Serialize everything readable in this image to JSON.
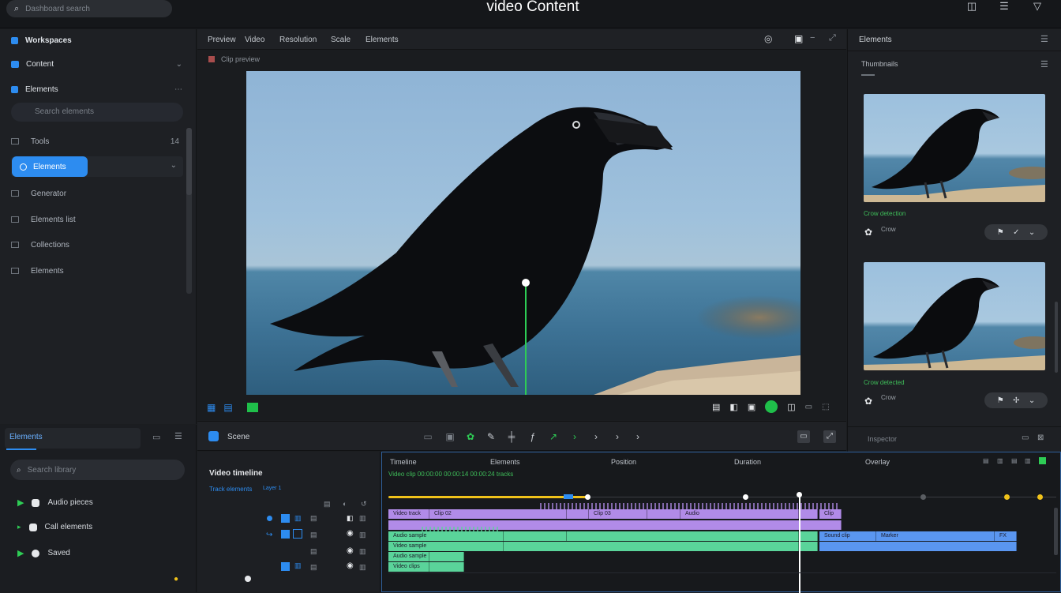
{
  "app": {
    "title": "video Content"
  },
  "search": {
    "placeholder": "Dashboard search"
  },
  "top_icons": [
    "crop-icon",
    "menu-icon",
    "filter-icon"
  ],
  "left_panel": {
    "header": "Workspaces",
    "section": "Content",
    "subsection": "Elements",
    "filter_placeholder": "Search elements",
    "items": [
      {
        "label": "Tools",
        "icon": "tool-icon",
        "badge": "14"
      },
      {
        "label": "Elements",
        "icon": "element-icon",
        "active": true
      },
      {
        "label": "Generator",
        "icon": "box-icon"
      },
      {
        "label": "Elements list",
        "icon": "list-icon"
      },
      {
        "label": "Collections",
        "icon": "folder-icon"
      },
      {
        "label": "Elements",
        "icon": "grid-icon"
      }
    ]
  },
  "left_bottom": {
    "tab": "Elements",
    "search_placeholder": "Search library",
    "items": [
      {
        "label": "Audio pieces",
        "color": "#2ecc55"
      },
      {
        "label": "Call elements",
        "color": "#2ecc55"
      },
      {
        "label": "Saved",
        "color": "#2ecc55"
      }
    ]
  },
  "preview": {
    "tabs": [
      "Preview",
      "Video",
      "Resolution",
      "Scale",
      "Elements"
    ],
    "breadcrumb": "Clip preview"
  },
  "right_panel": {
    "header": "Elements",
    "section": "Thumbnails",
    "cards": [
      {
        "caption": "Crow detection",
        "name": "Crow"
      },
      {
        "caption": "Crow detected",
        "name": "Crow"
      }
    ],
    "footer": "Inspector"
  },
  "transport": {
    "label": "Scene",
    "buttons": [
      "grid-icon",
      "monitor-icon",
      "cut-icon",
      "pen-icon",
      "split-icon",
      "blade-icon",
      "left-icon",
      "play-icon",
      "next-icon",
      "forward-icon",
      "end-icon"
    ]
  },
  "tracks": {
    "title": "Video timeline",
    "subtitle": "Track elements",
    "tag": "Layer 1"
  },
  "timeline": {
    "labels": [
      "Timeline",
      "Elements",
      "Position",
      "Duration",
      "Overlay"
    ],
    "summary": "Video clip 00:00:00 00:00:14 00:00:24 tracks",
    "clips_purple": [
      "Video track",
      "Clip 02",
      "Clip 03",
      "Audio",
      "Clip"
    ],
    "clips_green": [
      "Audio sample",
      "Video sample"
    ],
    "clips_blue": [
      "Sound clip",
      "Marker",
      "FX"
    ],
    "extra": [
      "Audio sample",
      "Video clips"
    ],
    "colors": {
      "accent": "#2d8cf0",
      "purple": "#b18be8",
      "green": "#5ad49a",
      "blue": "#5a96f0",
      "yellow": "#f0c21a"
    }
  }
}
